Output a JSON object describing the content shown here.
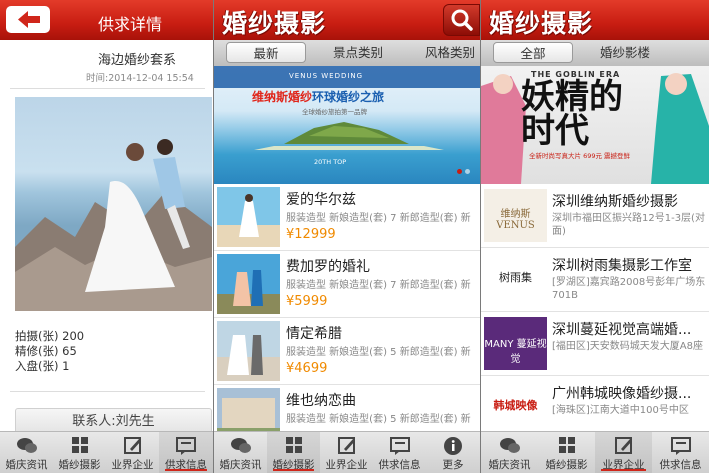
{
  "screen1": {
    "header_title": "供求详情",
    "title": "海边婚纱套系",
    "time": "时间:2014-12-04 15:54",
    "specs": [
      "拍摄(张) 200",
      "精修(张) 65",
      "入盘(张) 1"
    ],
    "contact": "联系人:刘先生",
    "nav": [
      {
        "label": "婚庆资讯",
        "icon": "chat-bubbles-icon"
      },
      {
        "label": "婚纱摄影",
        "icon": "grid-icon"
      },
      {
        "label": "业界企业",
        "icon": "edit-icon"
      },
      {
        "label": "供求信息",
        "icon": "message-icon"
      }
    ],
    "active_nav": 3
  },
  "screen2": {
    "brand": "婚纱摄影",
    "tabs": [
      "最新",
      "景点类别",
      "风格类别"
    ],
    "active_tab": 0,
    "banner": {
      "kicker": "VENUS WEDDING",
      "title_red": "维纳斯婚纱",
      "title_blue": "环球婚纱之旅",
      "sub": "全球婚纱旅拍第一品牌",
      "foot": "20TH TOP"
    },
    "items": [
      {
        "title": "爱的华尔兹",
        "desc": "服装造型 新娘造型(套) 7 新郎造型(套) 新",
        "price": "¥12999"
      },
      {
        "title": "费加罗的婚礼",
        "desc": "服装造型 新娘造型(套) 7 新郎造型(套) 新",
        "price": "¥5999"
      },
      {
        "title": "情定希腊",
        "desc": "服装造型 新娘造型(套) 5 新郎造型(套) 新",
        "price": "¥4699"
      },
      {
        "title": "维也纳恋曲",
        "desc": "服装造型 新娘造型(套) 5 新郎造型(套) 新",
        "price": ""
      }
    ],
    "nav": [
      {
        "label": "婚庆资讯",
        "icon": "chat-bubbles-icon"
      },
      {
        "label": "婚纱摄影",
        "icon": "grid-icon"
      },
      {
        "label": "业界企业",
        "icon": "edit-icon"
      },
      {
        "label": "供求信息",
        "icon": "message-icon"
      },
      {
        "label": "更多",
        "icon": "info-icon"
      }
    ],
    "active_nav": 1
  },
  "screen3": {
    "brand": "婚纱摄影",
    "tabs": [
      "全部",
      "婚纱影楼"
    ],
    "active_tab": 0,
    "banner": {
      "kicker": "THE GOBLIN ERA",
      "big_line1": "妖精的",
      "big_line2": "时代",
      "sub": "全新时尚写真大片 699元 震撼登鲜"
    },
    "shops": [
      {
        "name": "深圳维纳斯婚纱摄影",
        "addr": "深圳市福田区振兴路12号1-3层(对面)",
        "logo": "维纳斯 VENUS"
      },
      {
        "name": "深圳树雨集摄影工作室",
        "addr": "[罗湖区]嘉宾路2008号彭年广场东701B",
        "logo": "树雨集"
      },
      {
        "name": "深圳蔓延视觉高端婚...",
        "addr": "[福田区]天安数码城天发大厦A8座",
        "logo": "MANY 蔓延视觉"
      },
      {
        "name": "广州韩城映像婚纱摄...",
        "addr": "[海珠区]江南大道中100号中区",
        "logo": "韩城映像"
      }
    ],
    "nav": [
      {
        "label": "婚庆资讯",
        "icon": "chat-bubbles-icon"
      },
      {
        "label": "婚纱摄影",
        "icon": "grid-icon"
      },
      {
        "label": "业界企业",
        "icon": "edit-icon"
      },
      {
        "label": "供求信息",
        "icon": "message-icon"
      }
    ],
    "active_nav": 2
  },
  "colors": {
    "brand_red": "#c81d12",
    "price_orange": "#f08a00",
    "nav_active_line": "#d0261a"
  }
}
